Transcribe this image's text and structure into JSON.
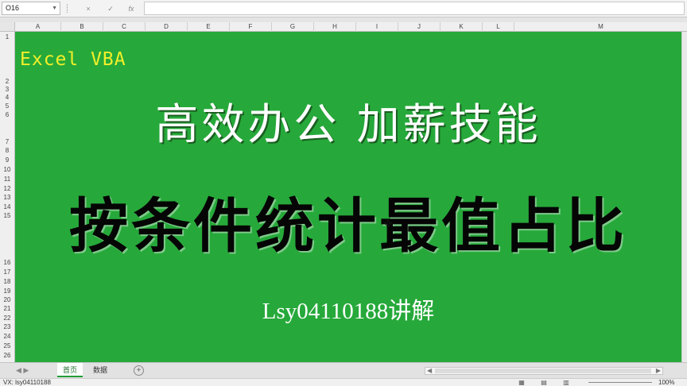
{
  "formula_bar": {
    "name_box": "O16",
    "cancel_icon": "×",
    "enter_icon": "✓",
    "fx_label": "fx",
    "formula": ""
  },
  "columns": [
    "A",
    "B",
    "C",
    "D",
    "E",
    "F",
    "G",
    "H",
    "I",
    "J",
    "K",
    "L",
    "M"
  ],
  "rows": [
    "1",
    "2",
    "3",
    "4",
    "5",
    "6",
    "7",
    "8",
    "9",
    "10",
    "11",
    "12",
    "13",
    "14",
    "15",
    "16",
    "17",
    "18",
    "19",
    "20",
    "21",
    "22",
    "23",
    "24",
    "25",
    "26"
  ],
  "overlay": {
    "tag": "Excel VBA",
    "headline_1": "高效办公 加薪技能",
    "headline_2": "按条件统计最值占比",
    "author": "Lsy04110188讲解",
    "cursor_icon": "✥"
  },
  "sheets": [
    {
      "label": "首页",
      "active": true
    },
    {
      "label": "数据",
      "active": false
    }
  ],
  "tab_nav": "◀ ▶",
  "add_sheet_icon": "+",
  "status": {
    "left_text": "VX: lsy04110188",
    "zoom": "100%"
  },
  "colors": {
    "sheet_bg": "#26a93a",
    "tag": "#f2ef2a",
    "headline_1": "#ffffff",
    "headline_2": "#050505"
  }
}
